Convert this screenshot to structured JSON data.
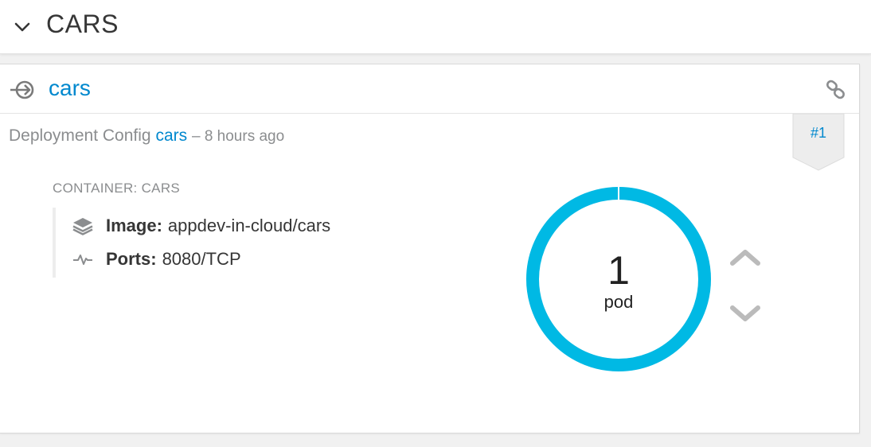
{
  "header": {
    "title": "CARS",
    "collapse_icon": "chevron-down-icon"
  },
  "service": {
    "icon": "service-icon",
    "name": "cars",
    "route_icon": "link-icon"
  },
  "deployment": {
    "prefix": "Deployment Config",
    "config_name": "cars",
    "age": "– 8 hours ago",
    "badge": "#1"
  },
  "container": {
    "label": "CONTAINER: CARS",
    "image_label": "Image:",
    "image_value": "appdev-in-cloud/cars",
    "image_icon": "layers-icon",
    "ports_label": "Ports:",
    "ports_value": "8080/TCP",
    "ports_icon": "pulse-icon"
  },
  "pods": {
    "count": "1",
    "label": "pod",
    "running_fraction": 1.0,
    "ring_color": "#00b9e4"
  },
  "scale": {
    "up_icon": "chevron-up-icon",
    "down_icon": "chevron-down-icon"
  },
  "colors": {
    "link": "#0088ce",
    "muted": "#8b8d8f",
    "icon_gray": "#bbbbbb"
  }
}
